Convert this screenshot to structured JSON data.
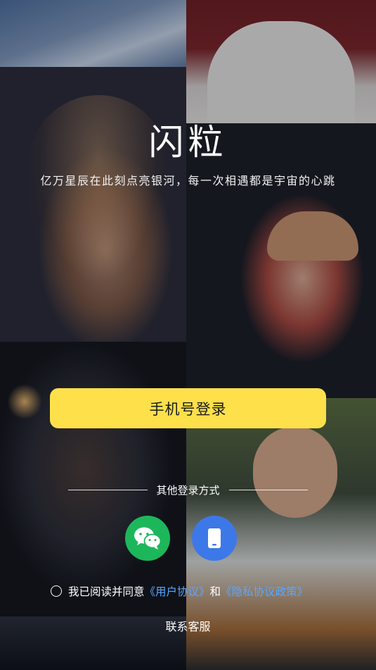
{
  "app": {
    "name": "闪粒",
    "slogan": "亿万星辰在此刻点亮银河，每一次相遇都是宇宙的心跳"
  },
  "login": {
    "primary_label": "手机号登录",
    "other_methods_label": "其他登录方式",
    "methods": [
      {
        "name": "wechat",
        "icon": "wechat-icon",
        "color": "#1db75b"
      },
      {
        "name": "phone",
        "icon": "phone-icon",
        "color": "#3d78e8"
      }
    ]
  },
  "agreement": {
    "prefix": "我已阅读并同意",
    "user_agreement": "《用户协议》",
    "conjunction": "和",
    "privacy_policy": "《隐私协议政策》",
    "checked": false
  },
  "support": {
    "label": "联系客服"
  },
  "colors": {
    "primary_button": "#fde04a",
    "link": "#5aa7ff"
  }
}
